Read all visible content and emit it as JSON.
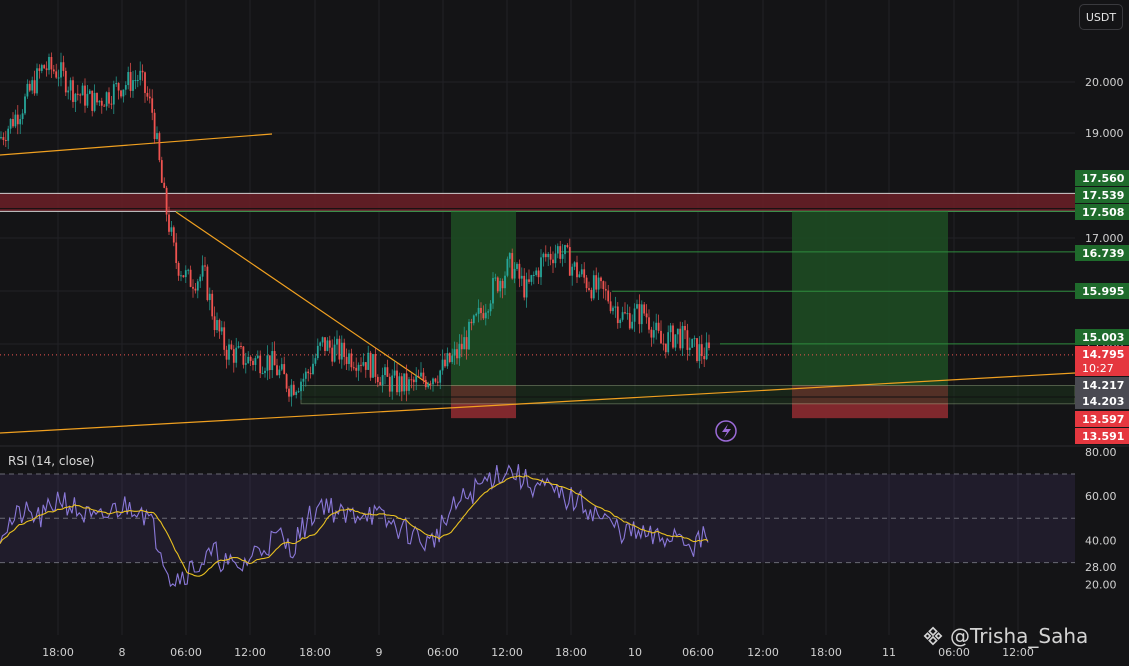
{
  "currency_label": "USDT",
  "watermark_handle": "@Trisha_Saha",
  "indicator_label": "RSI (14, close)",
  "colors": {
    "background": "#141416",
    "bull": "#26a69a",
    "bear": "#ef5350",
    "trendline": "#f0a020",
    "rsi_line": "#8a78d8",
    "rsi_ma": "#e8c020",
    "resistance_zone": "#6b1f27",
    "profit_zone": "#1d4a22",
    "loss_zone": "#8c2a30"
  },
  "chart_data": {
    "type": "candlestick",
    "price_axis": {
      "ticks": [
        "20.000",
        "19.000",
        "17.000",
        "16.000",
        "15.000"
      ],
      "tick_values": [
        20,
        19,
        17,
        16,
        15
      ]
    },
    "price_labels": [
      {
        "text": "17.560",
        "value": 17.56,
        "style": "green"
      },
      {
        "text": "17.539",
        "value": 17.539,
        "style": "green"
      },
      {
        "text": "17.508",
        "value": 17.508,
        "style": "green"
      },
      {
        "text": "16.739",
        "value": 16.739,
        "style": "green"
      },
      {
        "text": "15.995",
        "value": 15.995,
        "style": "green"
      },
      {
        "text": "15.003",
        "value": 15.003,
        "style": "green"
      },
      {
        "text": "14.795",
        "value": 14.795,
        "style": "red",
        "subtext": "10:27"
      },
      {
        "text": "14.217",
        "value": 14.217,
        "style": "gray"
      },
      {
        "text": "14.203",
        "value": 14.203,
        "style": "gray"
      },
      {
        "text": "13.597",
        "value": 13.597,
        "style": "red"
      },
      {
        "text": "13.591",
        "value": 13.591,
        "style": "red"
      }
    ],
    "time_axis": [
      "18:00",
      "8",
      "06:00",
      "12:00",
      "18:00",
      "9",
      "06:00",
      "12:00",
      "18:00",
      "10",
      "06:00",
      "12:00",
      "18:00",
      "11",
      "06:00",
      "12:00"
    ],
    "rsi_axis": {
      "ticks": [
        "80.00",
        "60.00",
        "40.00",
        "28.00",
        "20.00"
      ],
      "tick_values": [
        80,
        60,
        40,
        28,
        20
      ]
    },
    "price_path": [
      [
        18.9,
        0.0
      ],
      [
        19.5,
        0.02
      ],
      [
        20.3,
        0.04
      ],
      [
        20.2,
        0.055
      ],
      [
        19.8,
        0.07
      ],
      [
        19.6,
        0.09
      ],
      [
        19.9,
        0.11
      ],
      [
        20.1,
        0.13
      ],
      [
        19.4,
        0.142
      ],
      [
        17.8,
        0.152
      ],
      [
        17.5,
        0.155
      ],
      [
        16.6,
        0.163
      ],
      [
        16.2,
        0.175
      ],
      [
        16.3,
        0.19
      ],
      [
        15.4,
        0.2
      ],
      [
        14.9,
        0.21
      ],
      [
        14.7,
        0.23
      ],
      [
        14.7,
        0.25
      ],
      [
        14.2,
        0.27
      ],
      [
        14.4,
        0.285
      ],
      [
        15.0,
        0.3
      ],
      [
        14.8,
        0.32
      ],
      [
        14.7,
        0.34
      ],
      [
        14.3,
        0.36
      ],
      [
        14.2,
        0.38
      ],
      [
        14.4,
        0.4
      ],
      [
        14.5,
        0.41
      ],
      [
        14.8,
        0.425
      ],
      [
        15.3,
        0.44
      ],
      [
        16.1,
        0.46
      ],
      [
        16.5,
        0.475
      ],
      [
        16.0,
        0.49
      ],
      [
        16.6,
        0.505
      ],
      [
        16.8,
        0.52
      ],
      [
        16.4,
        0.535
      ],
      [
        16.1,
        0.55
      ],
      [
        15.9,
        0.565
      ],
      [
        15.5,
        0.58
      ],
      [
        15.6,
        0.6
      ],
      [
        15.0,
        0.615
      ],
      [
        15.2,
        0.63
      ],
      [
        14.9,
        0.645
      ],
      [
        14.8,
        0.66
      ]
    ],
    "rsi_path": [
      [
        44,
        0.0
      ],
      [
        52,
        0.02
      ],
      [
        50,
        0.04
      ],
      [
        60,
        0.055
      ],
      [
        54,
        0.07
      ],
      [
        48,
        0.09
      ],
      [
        55,
        0.11
      ],
      [
        56,
        0.13
      ],
      [
        48,
        0.14
      ],
      [
        34,
        0.152
      ],
      [
        22,
        0.16
      ],
      [
        28,
        0.18
      ],
      [
        34,
        0.2
      ],
      [
        26,
        0.22
      ],
      [
        36,
        0.24
      ],
      [
        42,
        0.26
      ],
      [
        36,
        0.27
      ],
      [
        48,
        0.285
      ],
      [
        58,
        0.3
      ],
      [
        50,
        0.32
      ],
      [
        54,
        0.34
      ],
      [
        48,
        0.36
      ],
      [
        44,
        0.38
      ],
      [
        38,
        0.4
      ],
      [
        46,
        0.41
      ],
      [
        56,
        0.425
      ],
      [
        62,
        0.44
      ],
      [
        70,
        0.46
      ],
      [
        72,
        0.475
      ],
      [
        66,
        0.49
      ],
      [
        64,
        0.505
      ],
      [
        60,
        0.52
      ],
      [
        58,
        0.535
      ],
      [
        54,
        0.55
      ],
      [
        48,
        0.565
      ],
      [
        44,
        0.58
      ],
      [
        42,
        0.6
      ],
      [
        40,
        0.615
      ],
      [
        44,
        0.63
      ],
      [
        38,
        0.645
      ],
      [
        42,
        0.66
      ]
    ],
    "ohlc_note": "candles are procedurally approximated along price_path",
    "rsi_levels": [
      70,
      50,
      30
    ]
  }
}
